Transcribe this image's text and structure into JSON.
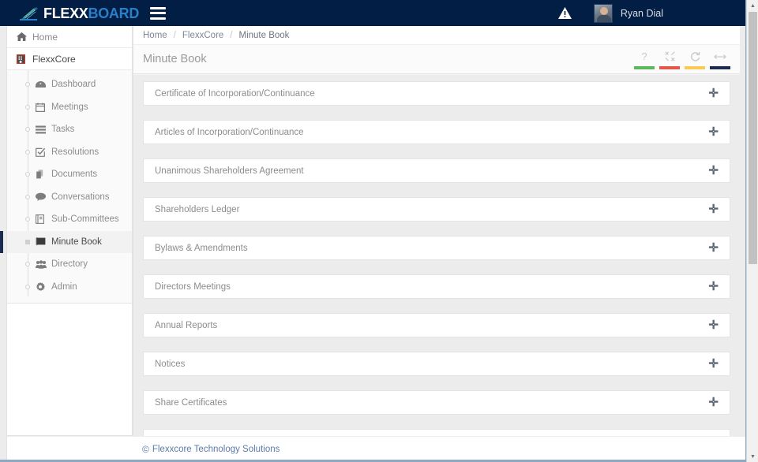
{
  "header": {
    "logo_flexx": "FLEXX",
    "logo_board": "BOARD",
    "menu_icon": "hamburger-icon",
    "alert_icon": "warning-triangle-icon",
    "user_name": "Ryan Dial",
    "bg_color": "#031e45"
  },
  "breadcrumb": {
    "items": [
      "Home",
      "FlexxCore",
      "Minute Book"
    ],
    "separator": "/"
  },
  "sidebar": {
    "top_items": [
      {
        "label": "Home",
        "icon": "home-icon"
      },
      {
        "label": "FlexxCore",
        "icon": "building-icon"
      }
    ],
    "sub_items": [
      {
        "label": "Dashboard",
        "icon": "dashboard-icon",
        "active": false
      },
      {
        "label": "Meetings",
        "icon": "calendar-icon",
        "active": false
      },
      {
        "label": "Tasks",
        "icon": "tasks-icon",
        "active": false
      },
      {
        "label": "Resolutions",
        "icon": "checkbox-icon",
        "active": false
      },
      {
        "label": "Documents",
        "icon": "documents-icon",
        "active": false
      },
      {
        "label": "Conversations",
        "icon": "chat-bubble-icon",
        "active": false
      },
      {
        "label": "Sub-Committees",
        "icon": "book-icon",
        "active": false
      },
      {
        "label": "Minute Book",
        "icon": "minute-book-icon",
        "active": true
      },
      {
        "label": "Directory",
        "icon": "people-icon",
        "active": false
      },
      {
        "label": "Admin",
        "icon": "gear-icon",
        "active": false
      }
    ],
    "active_marker_color": "#1b2a4e"
  },
  "panel": {
    "title": "Minute Book",
    "tools": [
      {
        "name": "help-tool",
        "glyph": "?",
        "color": "#5cb85c"
      },
      {
        "name": "collapse-tool",
        "glyph": "⤧",
        "color": "#e4564a"
      },
      {
        "name": "refresh-tool",
        "glyph": "⟳",
        "color": "#fcca51"
      },
      {
        "name": "expand-width-tool",
        "glyph": "↔",
        "color": "#1b2a4e"
      }
    ]
  },
  "accordion": {
    "expand_glyph": "✛",
    "items": [
      {
        "label": "Certificate of Incorporation/Continuance"
      },
      {
        "label": "Articles of Incorporation/Continuance"
      },
      {
        "label": "Unanimous Shareholders Agreement"
      },
      {
        "label": "Shareholders Ledger"
      },
      {
        "label": "Bylaws & Amendments"
      },
      {
        "label": "Directors Meetings"
      },
      {
        "label": "Annual Reports"
      },
      {
        "label": "Notices"
      },
      {
        "label": "Share Certificates"
      },
      {
        "label": ""
      }
    ]
  },
  "footer": {
    "copyright_symbol": "©",
    "text": "Flexxcore Technology Solutions"
  },
  "scrollbar": {
    "up_arrow": "▲",
    "down_arrow": "▼"
  }
}
